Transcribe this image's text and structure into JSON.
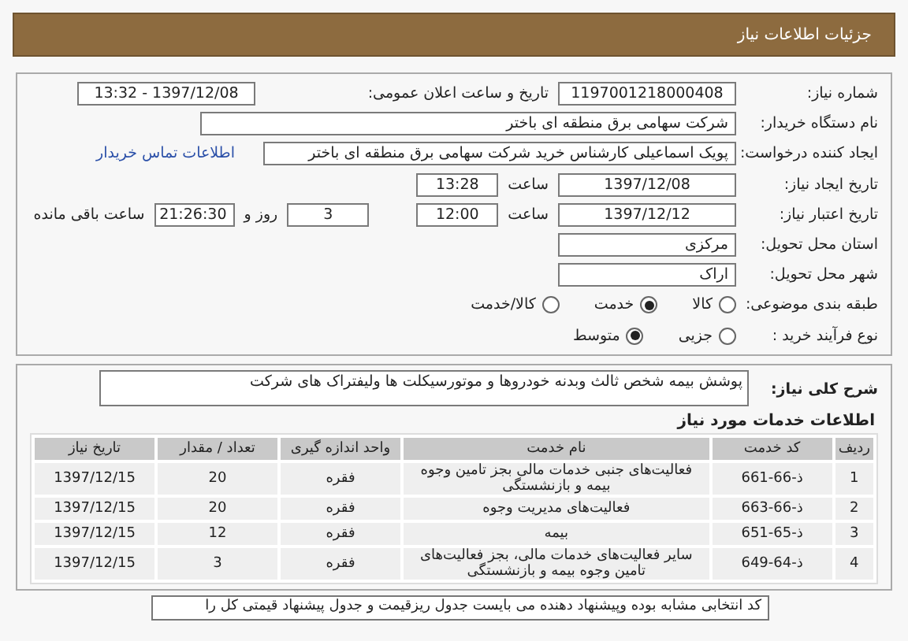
{
  "header": {
    "title": "جزئیات اطلاعات نیاز"
  },
  "details": {
    "need_number": {
      "label": "شماره نیاز:",
      "value": "1197001218000408"
    },
    "announce": {
      "label": "تاریخ و ساعت اعلان عمومی:",
      "value": "1397/12/08 - 13:32"
    },
    "buyer": {
      "label": "نام دستگاه خریدار:",
      "value": "شرکت سهامی برق منطقه ای باختر"
    },
    "creator": {
      "label": "ایجاد کننده درخواست:",
      "value": "پویک اسماعیلی کارشناس خرید شرکت سهامی برق منطقه ای باختر",
      "link": "اطلاعات تماس خریدار"
    },
    "created": {
      "label": "تاریخ ایجاد نیاز:",
      "date": "1397/12/08",
      "time_label": "ساعت",
      "time": "13:28"
    },
    "deadline": {
      "label": "تاریخ اعتبار نیاز:",
      "date": "1397/12/12",
      "time_label": "ساعت",
      "time": "12:00",
      "days": "3",
      "days_label": "روز و",
      "remaining": "21:26:30",
      "remaining_label": "ساعت باقی مانده"
    },
    "province": {
      "label": "استان محل تحویل:",
      "value": "مرکزی"
    },
    "city": {
      "label": "شهر محل تحویل:",
      "value": "اراک"
    },
    "category": {
      "label": "طبقه بندی موضوعی:",
      "options": [
        {
          "label": "کالا",
          "selected": false
        },
        {
          "label": "خدمت",
          "selected": true
        },
        {
          "label": "کالا/خدمت",
          "selected": false
        }
      ]
    },
    "process": {
      "label": "نوع فرآیند خرید :",
      "options": [
        {
          "label": "جزیی",
          "selected": false
        },
        {
          "label": "متوسط",
          "selected": true
        }
      ]
    }
  },
  "description": {
    "label": "شرح کلی نیاز:",
    "value": "پوشش بیمه شخص ثالث وبدنه خودروها و موتورسیکلت ها ولیفتراک های شرکت"
  },
  "services": {
    "title": "اطلاعات خدمات مورد نیاز",
    "columns": [
      "ردیف",
      "کد خدمت",
      "نام خدمت",
      "واحد اندازه گیری",
      "تعداد / مقدار",
      "تاریخ نیاز"
    ],
    "rows": [
      [
        "1",
        "ذ-66-661",
        "فعالیت‌های جنبی خدمات مالی بجز تامین وجوه بیمه و بازنشستگی",
        "فقره",
        "20",
        "1397/12/15"
      ],
      [
        "2",
        "ذ-66-663",
        "فعالیت‌های مدیریت وجوه",
        "فقره",
        "20",
        "1397/12/15"
      ],
      [
        "3",
        "ذ-65-651",
        "بیمه",
        "فقره",
        "12",
        "1397/12/15"
      ],
      [
        "4",
        "ذ-64-649",
        "سایر فعالیت‌های خدمات مالی، بجز فعالیت‌های تامین وجوه بیمه و بازنشستگی",
        "فقره",
        "3",
        "1397/12/15"
      ]
    ]
  },
  "note": {
    "text": "کد انتخابی مشابه بوده وپیشنهاد دهنده می بایست جدول ریزقیمت و جدول پیشنهاد قیمتی کل را"
  }
}
